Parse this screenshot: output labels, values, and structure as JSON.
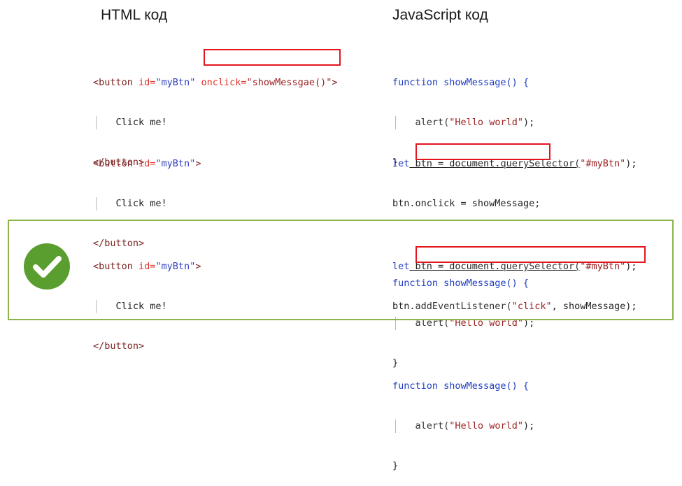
{
  "headings": {
    "html": "HTML код",
    "js": "JavaScript код"
  },
  "examples": [
    {
      "html": {
        "open_tag": "<button",
        "id_attr": " id=",
        "id_val": "\"myBtn\"",
        "space": " ",
        "onclick_attr": "onclick=",
        "onclick_val": "\"showMessgae()\"",
        "close": ">",
        "body": "Click me!",
        "end_tag": "</button>"
      },
      "js": {
        "line1": "function showMessage() {",
        "line2_fn": "alert(",
        "line2_str": "\"Hello world\"",
        "line2_end": ");",
        "line3": "}"
      }
    },
    {
      "html": {
        "open_tag": "<button",
        "id_attr": " id=",
        "id_val": "\"myBtn\"",
        "close": ">",
        "body": "Click me!",
        "end_tag": "</button>"
      },
      "js": {
        "let": "let",
        "btn_decl": " btn = document.",
        "qs": "querySelector(",
        "qs_str": "\"#myBtn\"",
        "qs_end": ");",
        "assign_obj": "btn.",
        "assign": "onclick = showMessage;",
        "fn_line": "function showMessage() {",
        "alert_fn": "alert(",
        "alert_str": "\"Hello world\"",
        "alert_end": ");",
        "close": "}"
      }
    },
    {
      "html": {
        "open_tag": "<button",
        "id_attr": " id=",
        "id_val": "\"myBtn\"",
        "close": ">",
        "body": "Click me!",
        "end_tag": "</button>"
      },
      "js": {
        "let": "let",
        "btn_decl": " btn = document.",
        "qs": "querySelector(",
        "qs_str": "\"#myBtn\"",
        "qs_end": ");",
        "listener_obj": "btn.",
        "listener_fn": "addEventListener(",
        "listener_str": "\"click\"",
        "listener_end": ", showMessage);",
        "fn_line": "function showMessage() {",
        "alert_fn": "alert(",
        "alert_str": "\"Hello world\"",
        "alert_end": ");",
        "close": "}"
      }
    }
  ],
  "colors": {
    "highlight_border": "#e3161d",
    "correct_frame": "#8bb44a",
    "check_circle": "#5a9e2f"
  },
  "icons": {
    "correct": "checkmark-icon"
  }
}
